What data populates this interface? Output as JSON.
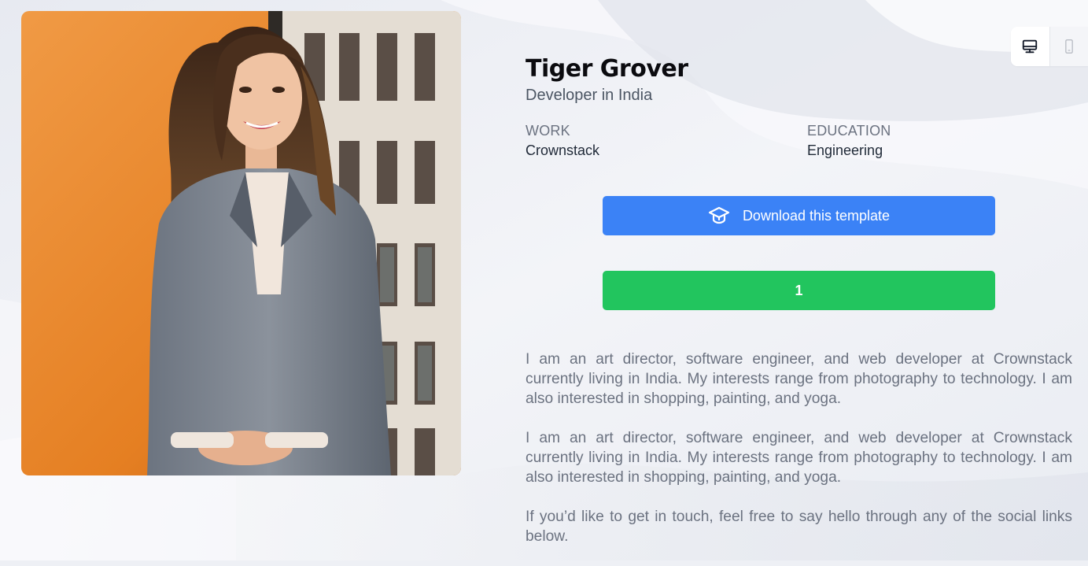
{
  "profile": {
    "name": "Tiger Grover",
    "title": "Developer in India",
    "work_label": "WORK",
    "work_value": "Crownstack",
    "education_label": "EDUCATION",
    "education_value": "Engineering",
    "photo_icon": "portrait-photo"
  },
  "actions": {
    "download_label": "Download this template",
    "download_icon": "graduation-cap-icon",
    "secondary_label": "1"
  },
  "about": {
    "paragraph1": "I am an art director, software engineer, and web developer at Crownstack currently living in India. My interests range from photography to technology. I am also interested in shopping, painting, and yoga.",
    "paragraph2": "I am an art director, software engineer, and web developer at Crownstack currently living in India. My interests range from photography to technology. I am also interested in shopping, painting, and yoga.",
    "paragraph3": "If you’d like to get in touch, feel free to say hello through any of the social links below."
  },
  "device_toggle": {
    "desktop_icon": "desktop-icon",
    "mobile_icon": "mobile-icon",
    "active": "desktop"
  },
  "colors": {
    "primary": "#3b82f6",
    "success": "#22c55e",
    "heading": "#0b0b0f",
    "muted": "#6b7280"
  }
}
